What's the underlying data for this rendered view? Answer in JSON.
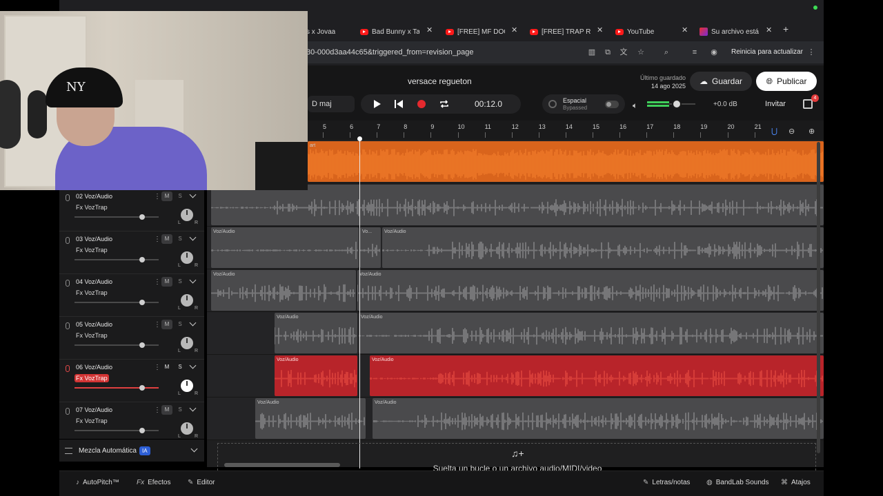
{
  "browser": {
    "tabs": [
      {
        "title": "s x Jovaa",
        "icon": "youtube-icon"
      },
      {
        "title": "Bad Bunny x Ta",
        "icon": "youtube-icon"
      },
      {
        "title": "[FREE] MF DOO",
        "icon": "youtube-icon"
      },
      {
        "title": "[FREE] TRAP RE",
        "icon": "youtube-icon"
      },
      {
        "title": "YouTube",
        "icon": "youtube-icon"
      },
      {
        "title": "Su archivo está",
        "icon": "bandlab-icon"
      }
    ],
    "url": "30-000d3aa44c65&triggered_from=revision_page",
    "update_button": "Reinicia para actualizar"
  },
  "header": {
    "song_title": "versace regueton",
    "saved_label": "Último guardado",
    "saved_date": "14 ago 2025",
    "save_button": "Guardar",
    "publish_button": "Publicar",
    "key": "D maj",
    "time": "00:12.0",
    "spatial_label": "Espacial",
    "spatial_state": "Bypassed",
    "master_db": "+0.0 dB",
    "invite_button": "Invitar",
    "notification_count": "4",
    "master_volume": 0.62
  },
  "ruler": {
    "ticks": [
      "5",
      "6",
      "7",
      "8",
      "9",
      "10",
      "11",
      "12",
      "13",
      "14",
      "15",
      "16",
      "17",
      "18",
      "19",
      "20",
      "21"
    ]
  },
  "tracks": [
    {
      "name": "02  Voz/Audio",
      "fx": "Fx VozTrap",
      "mute": "M",
      "solo": "S",
      "armed": false,
      "volume": 0.8
    },
    {
      "name": "03  Voz/Audio",
      "fx": "Fx VozTrap",
      "mute": "M",
      "solo": "S",
      "armed": false,
      "volume": 0.8
    },
    {
      "name": "04  Voz/Audio",
      "fx": "Fx VozTrap",
      "mute": "M",
      "solo": "S",
      "armed": false,
      "volume": 0.8
    },
    {
      "name": "05  Voz/Audio",
      "fx": "Fx VozTrap",
      "mute": "M",
      "solo": "S",
      "armed": false,
      "volume": 0.8
    },
    {
      "name": "06  Voz/Audio",
      "fx": "Fx VozTrap",
      "mute": "M",
      "solo": "S",
      "armed": true,
      "volume": 0.8
    },
    {
      "name": "07  Voz/Audio",
      "fx": "Fx VozTrap",
      "mute": "M",
      "solo": "S",
      "armed": false,
      "volume": 0.8
    }
  ],
  "pan_left": "L",
  "pan_right": "R",
  "automix": {
    "label": "Mezcla Automática",
    "badge": "IA"
  },
  "clips": {
    "label_voz": "Voz/Audio",
    "label_short": "Vo...",
    "label_beat": "art"
  },
  "dropzone_text": "Suelta un bucle o un archivo audio/MIDI/video",
  "bottombar": {
    "autopitch": "AutoPitch™",
    "effects": "Efectos",
    "editor": "Editor",
    "lyrics": "Letras/notas",
    "sounds": "BandLab Sounds",
    "shortcuts": "Atajos"
  },
  "colors": {
    "beat_clip": "#d9641c",
    "armed_clip": "#b8242a",
    "ia_badge": "#2d5fd6",
    "meter": "#3fcf5a"
  }
}
